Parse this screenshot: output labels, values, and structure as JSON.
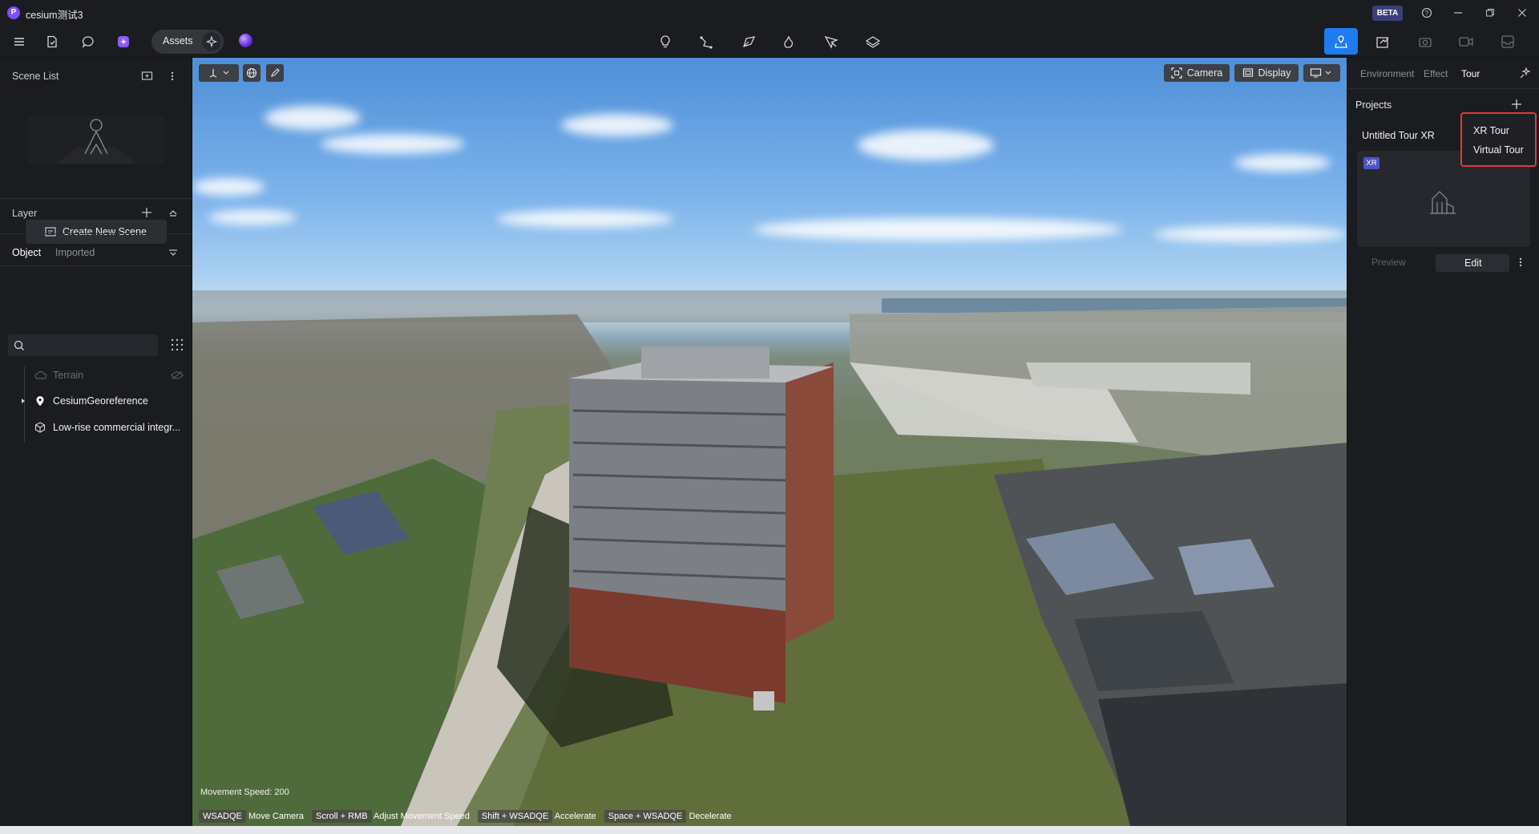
{
  "window": {
    "title": "cesium测试3",
    "beta_label": "BETA"
  },
  "toolbar": {
    "assets_label": "Assets",
    "center_tools": [
      "lightbulb-icon",
      "polyline-icon",
      "polygon-icon",
      "path-icon",
      "measure-icon",
      "layers-icon"
    ],
    "right_tools": [
      "tour-icon",
      "share-icon",
      "camera-icon",
      "video-icon",
      "inbox-icon"
    ]
  },
  "left_panel": {
    "scene_list_title": "Scene List",
    "create_scene_label": "Create New Scene",
    "layer_title": "Layer",
    "tabs": {
      "object": "Object",
      "imported": "Imported"
    },
    "tree": [
      {
        "label": "Terrain",
        "dimmed": true
      },
      {
        "label": "CesiumGeoreference",
        "dimmed": false
      },
      {
        "label": "Low-rise commercial integr...",
        "dimmed": false
      }
    ]
  },
  "viewport": {
    "buttons": {
      "camera": "Camera",
      "display": "Display"
    },
    "movement_speed": "Movement Speed: 200",
    "hints": [
      {
        "key": "WSADQE",
        "action": "Move Camera"
      },
      {
        "key": "Scroll + RMB",
        "action": "Adjust Movement Speed"
      },
      {
        "key": "Shift + WSADQE",
        "action": "Accelerate"
      },
      {
        "key": "Space + WSADQE",
        "action": "Decelerate"
      }
    ]
  },
  "right_panel": {
    "tabs": {
      "environment": "Environment",
      "effect": "Effect",
      "tour": "Tour"
    },
    "projects_title": "Projects",
    "project_name": "Untitled Tour XR",
    "project_badge": "XR",
    "preview_label": "Preview",
    "edit_label": "Edit",
    "dropdown": {
      "xr_tour": "XR Tour",
      "virtual_tour": "Virtual Tour"
    }
  },
  "colors": {
    "accent": "#1f7bf0",
    "highlight_border": "#e03a3a",
    "xr_badge": "#4b55c8"
  }
}
